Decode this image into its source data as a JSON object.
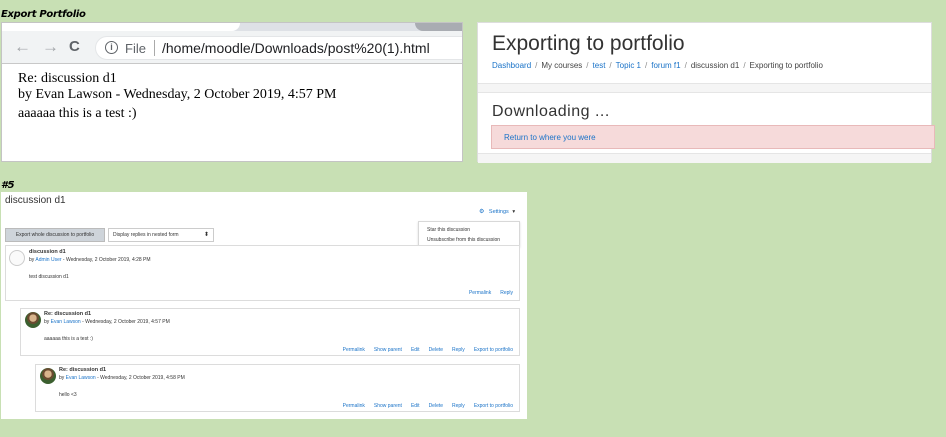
{
  "captions": {
    "top": "Export Portfolio",
    "bottom": "#5"
  },
  "browser": {
    "nav_back": "←",
    "nav_forward": "→",
    "nav_reload": "C",
    "info_glyph": "i",
    "url_scheme_label": "File",
    "url": "/home/moodle/Downloads/post%20(1).html",
    "page": {
      "title": "Re: discussion d1",
      "byline": "by Evan Lawson - Wednesday, 2 October 2019, 4:57 PM",
      "body": "aaaaaa this is a test :)"
    }
  },
  "moodle": {
    "title": "Exporting to portfolio",
    "breadcrumb": [
      {
        "label": "Dashboard",
        "link": true
      },
      {
        "label": "My courses",
        "link": false
      },
      {
        "label": "test",
        "link": true
      },
      {
        "label": "Topic 1",
        "link": true
      },
      {
        "label": "forum f1",
        "link": true
      },
      {
        "label": "discussion d1",
        "link": false
      },
      {
        "label": "Exporting to portfolio",
        "link": false
      }
    ],
    "separator": "/",
    "downloading": "Downloading ...",
    "return_link": "Return to where you were"
  },
  "discussion": {
    "title": "discussion d1",
    "settings_icon": "gear-icon",
    "settings_glyph": "⚙",
    "settings_label": "Settings",
    "settings_caret": "▾",
    "menu": [
      "Star this discussion",
      "Unsubscribe from this discussion"
    ],
    "export_button": "Export whole discussion to portfolio",
    "display_mode": "Display replies in nested form",
    "display_caret": "⬍",
    "by_prefix": "by ",
    "posts": [
      {
        "title": "discussion d1",
        "author": "Admin User",
        "date": " - Wednesday, 2 October 2019, 4:28 PM",
        "body": "test discussion d1",
        "actions": [
          "Permalink",
          "Reply"
        ]
      },
      {
        "title": "Re: discussion d1",
        "author": "Evan Lawson",
        "date": " - Wednesday, 2 October 2019, 4:57 PM",
        "body": "aaaaaa this is a test :)",
        "actions": [
          "Permalink",
          "Show parent",
          "Edit",
          "Delete",
          "Reply",
          "Export to portfolio"
        ]
      },
      {
        "title": "Re: discussion d1",
        "author": "Evan Lawson",
        "date": " - Wednesday, 2 October 2019, 4:58 PM",
        "body": "hello <3",
        "actions": [
          "Permalink",
          "Show parent",
          "Edit",
          "Delete",
          "Reply",
          "Export to portfolio"
        ]
      }
    ]
  },
  "colors": {
    "background": "#c8e0b4",
    "link": "#1a73c8",
    "alert_bg": "#f6dada"
  }
}
